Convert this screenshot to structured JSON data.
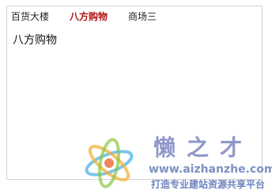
{
  "tabs": [
    {
      "label": "百货大楼",
      "active": false
    },
    {
      "label": "八方购物",
      "active": true
    },
    {
      "label": "商场三",
      "active": false
    }
  ],
  "content": {
    "text": "八方购物"
  },
  "watermark": {
    "brand": "懒之才",
    "url": "www.aizhanzhe.com",
    "slogan": "打造专业建站资源共享平台"
  }
}
